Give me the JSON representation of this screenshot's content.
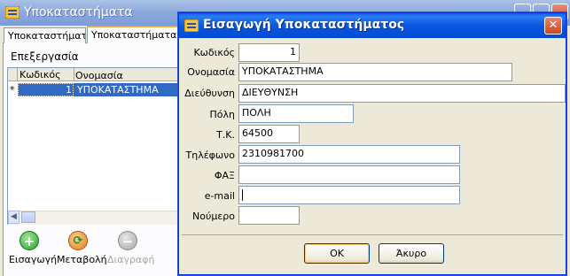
{
  "background_window": {
    "title": "Υποκαταστήματα",
    "tabs": [
      "Υποκαταστήματα",
      "Υποκαταστήματα με"
    ],
    "section_label": "Επεξεργασία",
    "grid": {
      "columns": [
        "Κωδικός",
        "Ονομασία"
      ],
      "rows": [
        {
          "marker": "*",
          "code": "1",
          "name": "ΥΠΟΚΑΤΑΣΤΗΜΑ"
        }
      ]
    },
    "toolbar": {
      "insert_label": "Εισαγωγή",
      "change_label": "Μεταβολή",
      "delete_label": "Διαγραφή"
    },
    "accent_color": "#316ac5"
  },
  "dialog": {
    "title": "Εισαγωγή Υποκαταστήματος",
    "fields": {
      "code": {
        "label": "Κωδικός",
        "value": "1"
      },
      "name": {
        "label": "Ονομασία",
        "value": "ΥΠΟΚΑΤΑΣΤΗΜΑ"
      },
      "address": {
        "label": "Διεύθυνση",
        "value": "ΔΙΕΥΘΥΝΣΗ"
      },
      "city": {
        "label": "Πόλη",
        "value": "ΠΟΛΗ"
      },
      "postal_code": {
        "label": "Τ.Κ.",
        "value": "64500"
      },
      "phone": {
        "label": "Τηλέφωνο",
        "value": "2310981700"
      },
      "fax": {
        "label": "ΦΑΞ",
        "value": ""
      },
      "email": {
        "label": "e-mail",
        "value": ""
      },
      "number": {
        "label": "Νούμερο",
        "value": ""
      }
    },
    "ok_label": "OK",
    "cancel_label": "Άκυρο",
    "title_bar_color": "#0a58df"
  }
}
